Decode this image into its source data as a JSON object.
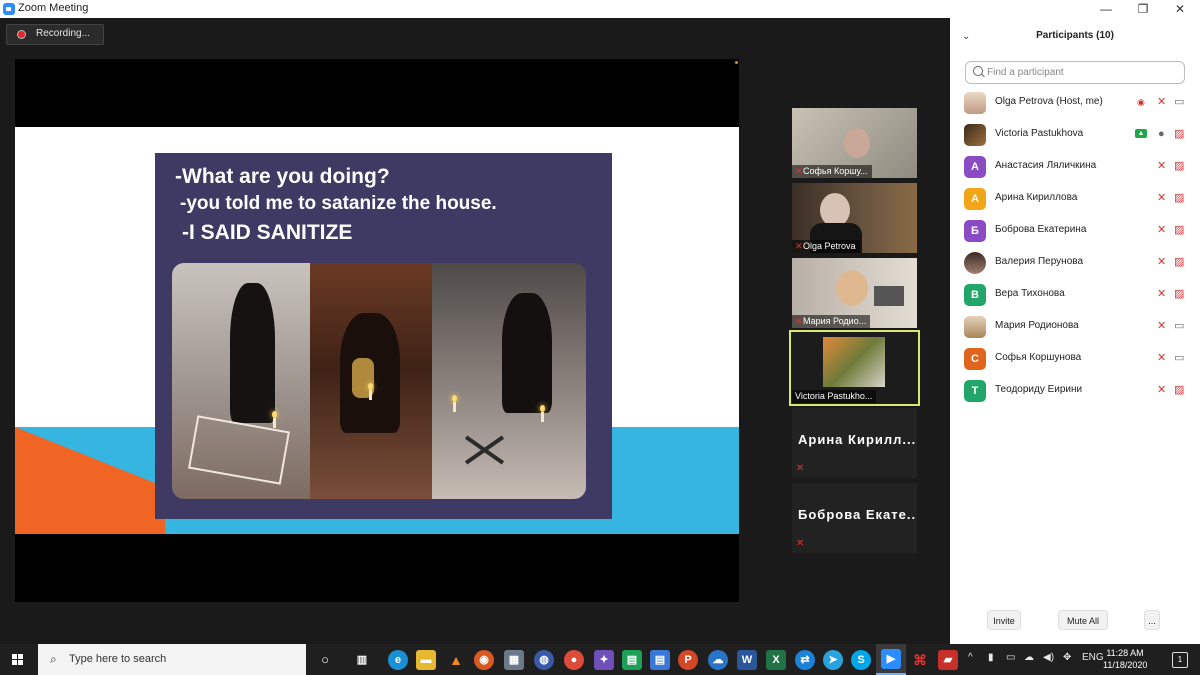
{
  "window": {
    "title": "Zoom Meeting",
    "minimize": "—",
    "maximize": "❐",
    "close": "✕"
  },
  "recording": {
    "label": "Recording..."
  },
  "slide": {
    "line1": "-What are you doing?",
    "line2": "-you told me to satanize the house.",
    "line3": "-I SAID SANITIZE"
  },
  "videos": [
    {
      "name": "Софья Коршу...",
      "muted": true
    },
    {
      "name": "Olga Petrova",
      "muted": true
    },
    {
      "name": "Мария Родио...",
      "muted": true
    },
    {
      "name": "Victoria Pastukho...",
      "muted": false,
      "active": true
    },
    {
      "name": "Арина  Кирилл...",
      "muted": true
    },
    {
      "name": "Боброва  Екате...",
      "muted": true
    }
  ],
  "panel": {
    "title": "Participants (10)",
    "search_placeholder": "Find a participant",
    "participants": [
      {
        "name": "Olga Petrova (Host, me)",
        "initial": "",
        "color": "#c9a58a",
        "photo": true
      },
      {
        "name": "Victoria Pastukhova",
        "initial": "",
        "color": "#6b5a4a",
        "photo": true
      },
      {
        "name": "Анастасия Ляличкина",
        "initial": "А",
        "color": "#8a4bc4"
      },
      {
        "name": "Арина Кириллова",
        "initial": "А",
        "color": "#f2a516"
      },
      {
        "name": "Боброва Екатерина",
        "initial": "Б",
        "color": "#8a4bc4"
      },
      {
        "name": "Валерия Перунова",
        "initial": "",
        "color": "#7b5b52",
        "photo": true
      },
      {
        "name": "Вера Тихонова",
        "initial": "В",
        "color": "#21a568"
      },
      {
        "name": "Мария Родионова",
        "initial": "",
        "color": "#b89a7a",
        "photo": true
      },
      {
        "name": "Софья Коршунова",
        "initial": "С",
        "color": "#e0641c"
      },
      {
        "name": "Теодориду Еирини",
        "initial": "Т",
        "color": "#21a568"
      }
    ],
    "invite_label": "Invite",
    "mute_all_label": "Mute All",
    "more_label": "..."
  },
  "taskbar": {
    "search_placeholder": "Type here to search",
    "language": "ENG",
    "time": "11:28 AM",
    "date": "11/18/2020",
    "notifications": "1"
  }
}
